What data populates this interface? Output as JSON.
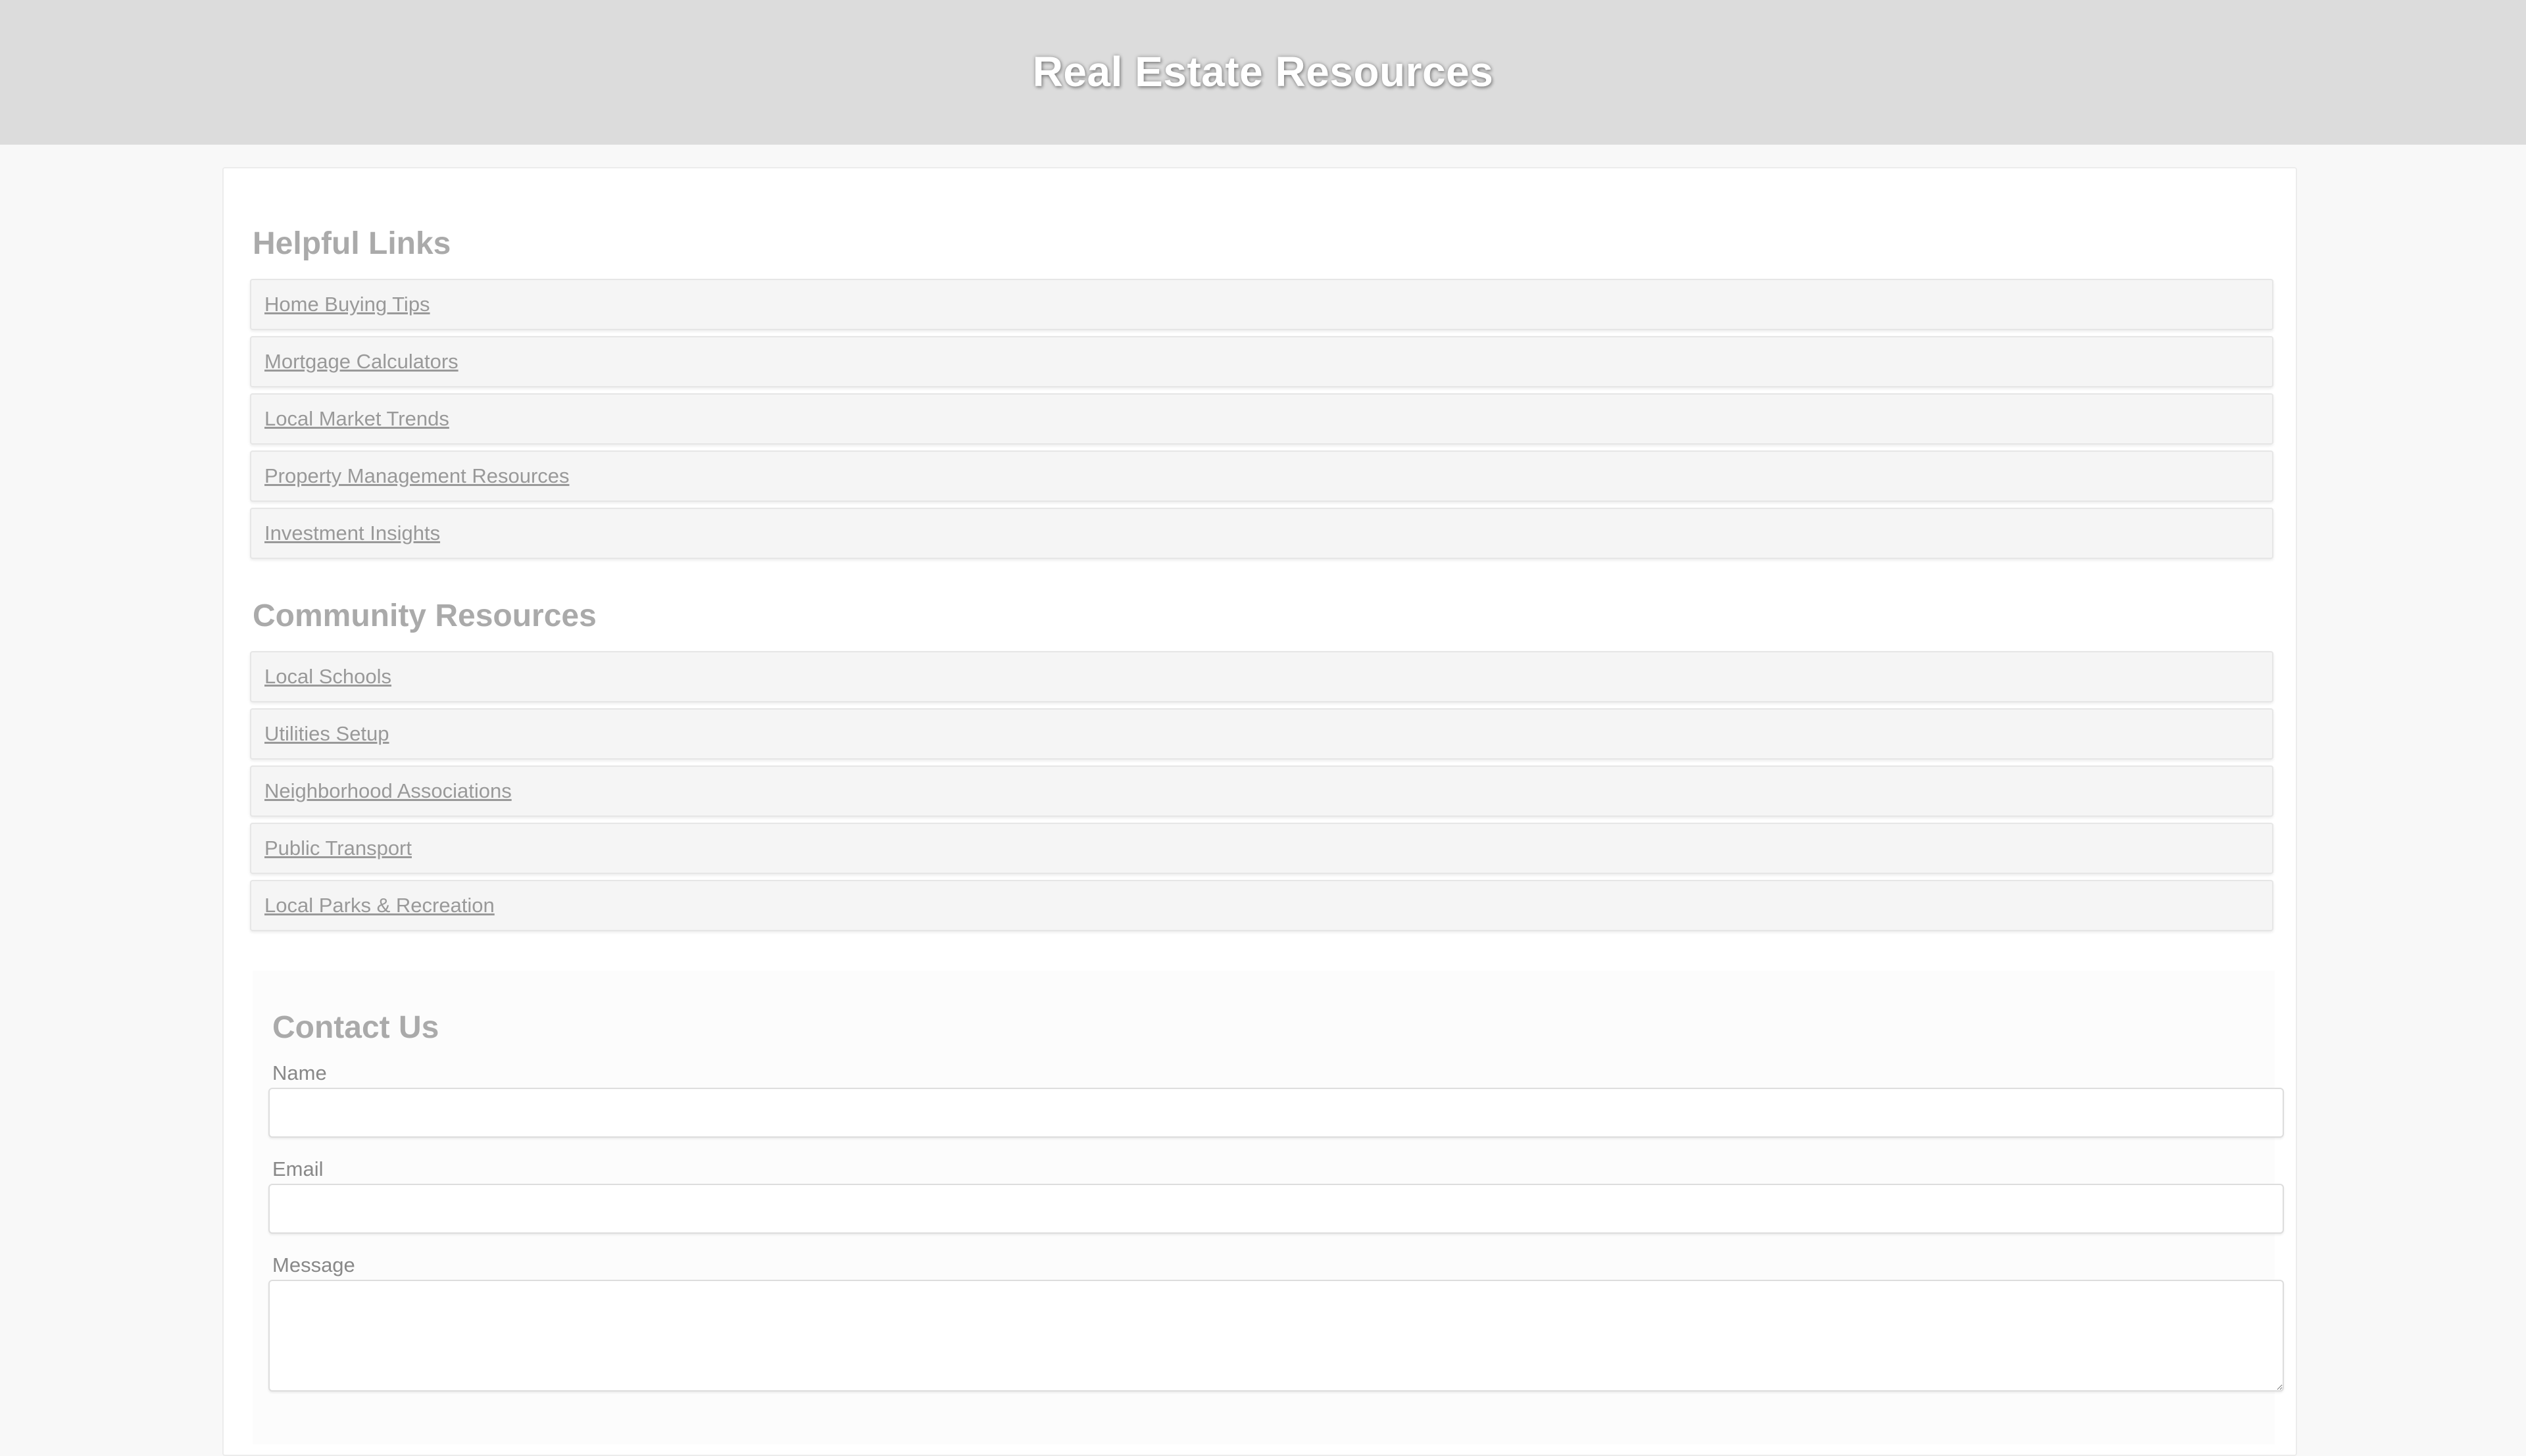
{
  "header": {
    "title": "Real Estate Resources"
  },
  "helpful_links": {
    "heading": "Helpful Links",
    "items": [
      {
        "label": "Home Buying Tips"
      },
      {
        "label": "Mortgage Calculators"
      },
      {
        "label": "Local Market Trends"
      },
      {
        "label": "Property Management Resources"
      },
      {
        "label": "Investment Insights"
      }
    ]
  },
  "community_resources": {
    "heading": "Community Resources",
    "items": [
      {
        "label": "Local Schools"
      },
      {
        "label": "Utilities Setup"
      },
      {
        "label": "Neighborhood Associations"
      },
      {
        "label": "Public Transport"
      },
      {
        "label": "Local Parks & Recreation"
      }
    ]
  },
  "contact": {
    "heading": "Contact Us",
    "fields": {
      "name": {
        "label": "Name",
        "value": ""
      },
      "email": {
        "label": "Email",
        "value": ""
      },
      "message": {
        "label": "Message",
        "value": ""
      }
    }
  },
  "colors": {
    "header_bg": "#dcdcdc",
    "title_text": "#ffffff",
    "page_bg": "#f8f8f8",
    "card_bg": "#ffffff",
    "link_item_bg": "#f5f5f5",
    "link_text": "#999999",
    "heading_text": "#aaaaaa"
  }
}
